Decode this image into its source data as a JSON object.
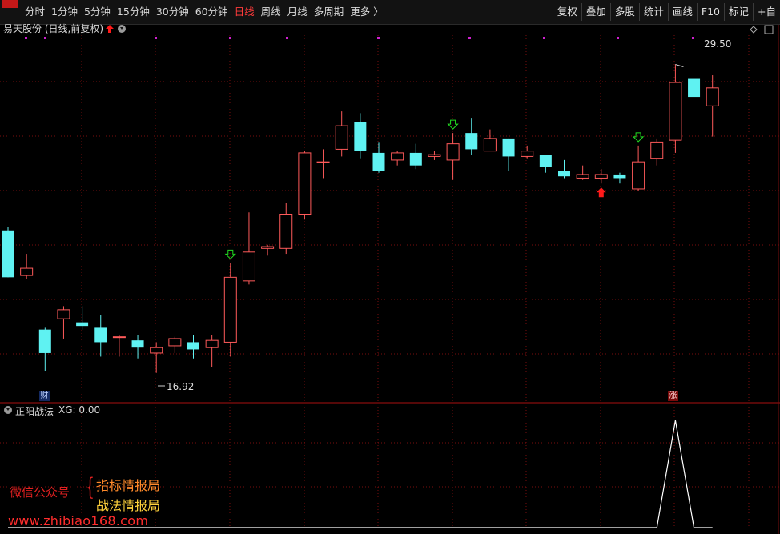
{
  "toolbar": {
    "periods": [
      "分时",
      "1分钟",
      "5分钟",
      "15分钟",
      "30分钟",
      "60分钟",
      "日线",
      "周线",
      "月线",
      "多周期",
      "更多 〉"
    ],
    "active_period": "日线",
    "tools": [
      "复权",
      "叠加",
      "多股",
      "统计",
      "画线",
      "F10",
      "标记",
      "+自"
    ]
  },
  "main_panel": {
    "stock_name": "易天股份",
    "chart_type_label": "(日线,前复权)",
    "high_label": "29.50",
    "low_label": "16.92",
    "badge_cai": "财",
    "badge_zhang": "涨"
  },
  "indicator_panel": {
    "name": "正阳战法",
    "value_text": "XG: 0.00"
  },
  "watermark": {
    "left": "微信公众号",
    "brace": "{",
    "line1": "指标情报局",
    "line2": "战法情报局",
    "url": "www.zhibiao168.com"
  },
  "colors": {
    "up": "#ff5a5a",
    "down": "#5ff2f2",
    "grid": "#7a0e0e",
    "signal_green": "#22dd22",
    "signal_red": "#ff1a1a",
    "dot_magenta": "#d020d0"
  },
  "chart_data": {
    "type": "candlestick",
    "candles": [
      {
        "o": 24.9,
        "h": 25.0,
        "l": 23.6,
        "c": 23.6
      },
      {
        "o": 23.65,
        "h": 24.25,
        "l": 23.55,
        "c": 23.85
      },
      {
        "o": 22.15,
        "h": 22.2,
        "l": 21.0,
        "c": 21.5
      },
      {
        "o": 22.45,
        "h": 22.8,
        "l": 21.9,
        "c": 22.7
      },
      {
        "o": 22.35,
        "h": 22.8,
        "l": 22.15,
        "c": 22.25
      },
      {
        "o": 22.2,
        "h": 22.55,
        "l": 21.4,
        "c": 21.8
      },
      {
        "o": 21.95,
        "h": 22.0,
        "l": 21.4,
        "c": 21.95
      },
      {
        "o": 21.85,
        "h": 22.0,
        "l": 21.35,
        "c": 21.65
      },
      {
        "o": 21.5,
        "h": 21.8,
        "l": 20.95,
        "c": 21.65
      },
      {
        "o": 21.7,
        "h": 21.95,
        "l": 21.5,
        "c": 21.9
      },
      {
        "o": 21.8,
        "h": 22.0,
        "l": 21.35,
        "c": 21.6
      },
      {
        "o": 21.65,
        "h": 22.0,
        "l": 21.1,
        "c": 21.85
      },
      {
        "o": 21.8,
        "h": 24.0,
        "l": 21.4,
        "c": 23.6
      },
      {
        "o": 23.5,
        "h": 25.4,
        "l": 23.4,
        "c": 24.3
      },
      {
        "o": 24.4,
        "h": 24.5,
        "l": 24.2,
        "c": 24.45
      },
      {
        "o": 24.4,
        "h": 25.65,
        "l": 24.25,
        "c": 25.35
      },
      {
        "o": 25.35,
        "h": 27.1,
        "l": 25.2,
        "c": 27.05
      },
      {
        "o": 26.8,
        "h": 27.15,
        "l": 26.35,
        "c": 26.8
      },
      {
        "o": 27.15,
        "h": 28.2,
        "l": 26.95,
        "c": 27.8
      },
      {
        "o": 27.9,
        "h": 28.15,
        "l": 26.9,
        "c": 27.1
      },
      {
        "o": 27.05,
        "h": 27.35,
        "l": 26.5,
        "c": 26.55
      },
      {
        "o": 26.85,
        "h": 27.1,
        "l": 26.7,
        "c": 27.05
      },
      {
        "o": 27.05,
        "h": 27.3,
        "l": 26.6,
        "c": 26.7
      },
      {
        "o": 26.95,
        "h": 27.1,
        "l": 26.85,
        "c": 27.0
      },
      {
        "o": 26.85,
        "h": 27.6,
        "l": 26.3,
        "c": 27.3
      },
      {
        "o": 27.6,
        "h": 28.0,
        "l": 27.0,
        "c": 27.15
      },
      {
        "o": 27.1,
        "h": 27.7,
        "l": 27.1,
        "c": 27.45
      },
      {
        "o": 27.45,
        "h": 27.45,
        "l": 26.55,
        "c": 26.95
      },
      {
        "o": 26.95,
        "h": 27.25,
        "l": 26.9,
        "c": 27.1
      },
      {
        "o": 27.0,
        "h": 27.0,
        "l": 26.5,
        "c": 26.65
      },
      {
        "o": 26.55,
        "h": 26.85,
        "l": 26.35,
        "c": 26.4
      },
      {
        "o": 26.35,
        "h": 26.7,
        "l": 26.3,
        "c": 26.45
      },
      {
        "o": 26.35,
        "h": 26.6,
        "l": 26.2,
        "c": 26.45
      },
      {
        "o": 26.45,
        "h": 26.5,
        "l": 26.2,
        "c": 26.35
      },
      {
        "o": 26.05,
        "h": 27.25,
        "l": 26.0,
        "c": 26.8
      },
      {
        "o": 26.9,
        "h": 27.45,
        "l": 26.7,
        "c": 27.35
      },
      {
        "o": 27.4,
        "h": 29.5,
        "l": 27.05,
        "c": 29.0
      },
      {
        "o": 29.1,
        "h": 29.1,
        "l": 28.6,
        "c": 28.6
      },
      {
        "o": 28.35,
        "h": 29.2,
        "l": 27.5,
        "c": 28.85
      }
    ],
    "markers": [
      {
        "index": 12,
        "type": "down-arrow-green"
      },
      {
        "index": 24,
        "type": "down-arrow-green"
      },
      {
        "index": 34,
        "type": "down-arrow-green"
      },
      {
        "index": 32,
        "type": "up-arrow-red"
      }
    ],
    "ylim": [
      20.5,
      30.2
    ],
    "indicator": {
      "name": "XG",
      "spike_index": 36,
      "values": [
        0,
        0,
        0,
        0,
        0,
        0,
        0,
        0,
        0,
        0,
        0,
        0,
        0,
        0,
        0,
        0,
        0,
        0,
        0,
        0,
        0,
        0,
        0,
        0,
        0,
        0,
        0,
        0,
        0,
        0,
        0,
        0,
        0,
        0,
        0,
        0,
        1,
        0,
        0
      ]
    }
  }
}
